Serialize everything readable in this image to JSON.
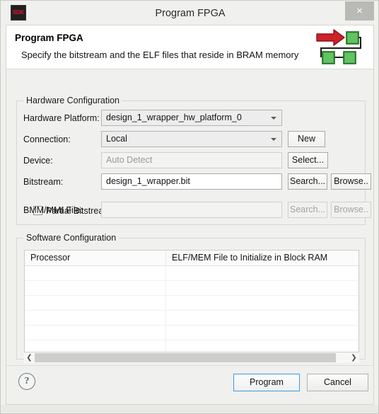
{
  "window": {
    "title": "Program FPGA",
    "app_icon_label": "SDK",
    "close_label": "×"
  },
  "header": {
    "title": "Program FPGA",
    "description": "Specify the bitstream and the ELF files that reside in BRAM memory",
    "icon_name": "fpga-flow-icon",
    "icon_colors": {
      "arrow": "#cc2229",
      "box": "#3ea33e",
      "wire": "#1a1a1a"
    }
  },
  "hardware_configuration": {
    "group_label": "Hardware Configuration",
    "rows": [
      {
        "label": "Hardware Platform:",
        "control": "combo",
        "value": "design_1_wrapper_hw_platform_0",
        "placeholder": "",
        "enabled": true,
        "buttons": []
      },
      {
        "label": "Connection:",
        "control": "combo",
        "value": "Local",
        "placeholder": "",
        "enabled": true,
        "buttons": [
          {
            "label": "New",
            "enabled": true
          }
        ]
      },
      {
        "label": "Device:",
        "control": "text",
        "value": "",
        "placeholder": "Auto Detect",
        "enabled": false,
        "buttons": [
          {
            "label": "Select...",
            "enabled": true
          }
        ]
      },
      {
        "label": "Bitstream:",
        "control": "text",
        "value": "design_1_wrapper.bit",
        "placeholder": "",
        "enabled": true,
        "buttons": [
          {
            "label": "Search...",
            "enabled": true
          },
          {
            "label": "Browse..",
            "enabled": true
          }
        ]
      },
      {
        "label": "BMM/MMI File:",
        "control": "text",
        "value": "",
        "placeholder": "",
        "enabled": false,
        "buttons": [
          {
            "label": "Search...",
            "enabled": false
          },
          {
            "label": "Browse..",
            "enabled": false
          }
        ]
      }
    ],
    "partial_bitstream": {
      "label": "Partial Bitstream",
      "checked": false
    }
  },
  "software_configuration": {
    "group_label": "Software Configuration",
    "table": {
      "columns": [
        "Processor",
        "ELF/MEM File to Initialize in Block RAM"
      ],
      "rows": [],
      "empty_row_count": 7,
      "scrollbar": {
        "orientation": "horizontal",
        "left_arrow": "❮",
        "right_arrow": "❯"
      }
    }
  },
  "footer": {
    "help_label": "?",
    "program_label": "Program",
    "cancel_label": "Cancel",
    "default_button": "Program"
  }
}
